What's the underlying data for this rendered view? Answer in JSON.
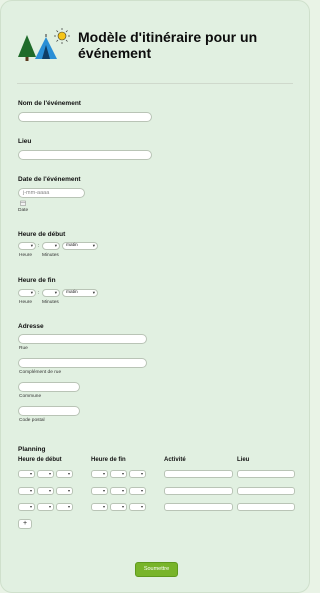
{
  "form": {
    "title": "Modèle d'itinéraire pour un événement",
    "event_name_label": "Nom de l'événement",
    "place_label": "Lieu",
    "date_label": "Date de l'événement",
    "date_placeholder": "j-mm-aaaa",
    "date_sublabel": "Date",
    "start_label": "Heure de début",
    "end_label": "Heure de fin",
    "hour_sublabel": "Heure",
    "minutes_sublabel": "Minutes",
    "ampm_value": "matin",
    "address_label": "Adresse",
    "street_sublabel": "Rue",
    "street2_sublabel": "Complément de rue",
    "city_sublabel": "Commune",
    "zip_sublabel": "Code postal",
    "planning_label": "Planning",
    "col_start": "Heure de début",
    "col_end": "Heure de fin",
    "col_activity": "Activité",
    "col_place": "Lieu",
    "add_label": "+",
    "submit_label": "Soumettre"
  },
  "colors": {
    "accent": "#78b42a",
    "background": "#e1f0e1"
  },
  "icons": [
    "tree-icon",
    "tent-icon",
    "sun-icon",
    "calendar-icon",
    "chevron-down-icon"
  ]
}
